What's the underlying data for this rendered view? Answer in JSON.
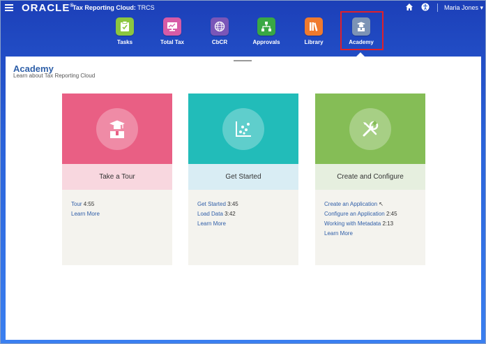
{
  "header": {
    "brand": "ORACLE",
    "app_title_bold": "Tax Reporting Cloud:",
    "app_title_rest": " TRCS",
    "user_name": "Maria Jones"
  },
  "nav": {
    "items": [
      {
        "label": "Tasks",
        "icon": "tasks-icon",
        "color": "#8cc63f"
      },
      {
        "label": "Total Tax",
        "icon": "total-tax-icon",
        "color": "#d75ba6"
      },
      {
        "label": "CbCR",
        "icon": "cbcr-globe-icon",
        "color": "#7a56b8"
      },
      {
        "label": "Approvals",
        "icon": "approvals-icon",
        "color": "#39a844"
      },
      {
        "label": "Library",
        "icon": "library-icon",
        "color": "#f07a2e"
      },
      {
        "label": "Academy",
        "icon": "academy-icon",
        "color": "#7c93b5"
      }
    ],
    "selected": "Academy",
    "highlight_color": "#e0202a"
  },
  "page": {
    "title": "Academy",
    "subtitle": "Learn about Tax Reporting Cloud"
  },
  "cards": [
    {
      "title": "Take a Tour",
      "icon": "student-icon",
      "hero_color": "#e95f84",
      "band_color": "#f8d7df",
      "links": [
        {
          "label": "Tour",
          "duration": "4:55"
        },
        {
          "label": "Learn More",
          "duration": ""
        }
      ]
    },
    {
      "title": "Get Started",
      "icon": "scatter-chart-icon",
      "hero_color": "#22bcb9",
      "band_color": "#d9edf4",
      "links": [
        {
          "label": "Get Started",
          "duration": "3:45"
        },
        {
          "label": "Load Data",
          "duration": "3:42"
        },
        {
          "label": "Learn More",
          "duration": ""
        }
      ]
    },
    {
      "title": "Create and Configure",
      "icon": "wrench-screwdriver-icon",
      "hero_color": "#85bd56",
      "band_color": "#e6efdf",
      "links": [
        {
          "label": "Create an Application",
          "duration": ""
        },
        {
          "label": "Configure an Application",
          "duration": "2:45"
        },
        {
          "label": "Working with Metadata",
          "duration": "2:13"
        },
        {
          "label": "Learn More",
          "duration": ""
        }
      ]
    }
  ]
}
